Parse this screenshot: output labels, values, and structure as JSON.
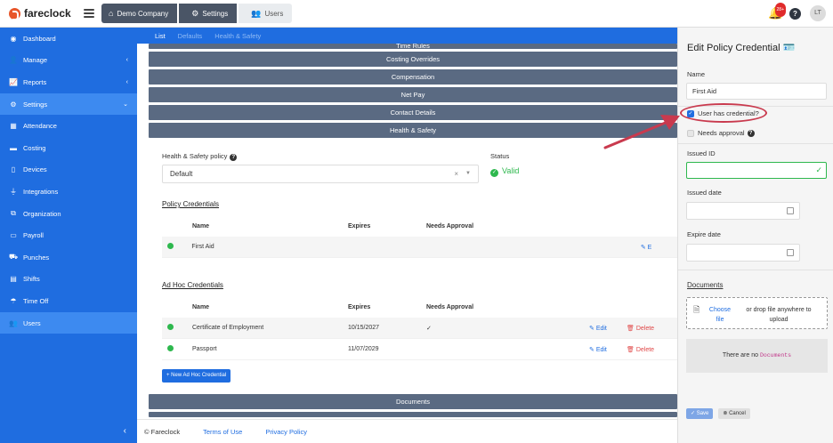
{
  "app": {
    "name": "fareclock"
  },
  "breadcrumbs": [
    {
      "label": "Demo Company",
      "icon": "home-icon"
    },
    {
      "label": "Settings",
      "icon": "gear-icon"
    },
    {
      "label": "Users",
      "icon": "users-icon"
    }
  ],
  "topbar": {
    "notifications": "28+",
    "help": "?",
    "avatar": "LT"
  },
  "sidebar": {
    "items": [
      {
        "label": "Dashboard",
        "icon": "dashboard-icon",
        "chevron": ""
      },
      {
        "label": "Manage",
        "icon": "person-icon",
        "chevron": "‹"
      },
      {
        "label": "Reports",
        "icon": "chart-icon",
        "chevron": "‹"
      },
      {
        "label": "Settings",
        "icon": "gear-icon",
        "chevron": "⌄"
      },
      {
        "label": "Attendance",
        "icon": "calendar-icon",
        "chevron": ""
      },
      {
        "label": "Costing",
        "icon": "folder-icon",
        "chevron": ""
      },
      {
        "label": "Devices",
        "icon": "device-icon",
        "chevron": ""
      },
      {
        "label": "Integrations",
        "icon": "plug-icon",
        "chevron": ""
      },
      {
        "label": "Organization",
        "icon": "sitemap-icon",
        "chevron": ""
      },
      {
        "label": "Payroll",
        "icon": "money-icon",
        "chevron": ""
      },
      {
        "label": "Punches",
        "icon": "truck-icon",
        "chevron": ""
      },
      {
        "label": "Shifts",
        "icon": "clipboard-icon",
        "chevron": ""
      },
      {
        "label": "Time Off",
        "icon": "beach-icon",
        "chevron": ""
      },
      {
        "label": "Users",
        "icon": "users-icon",
        "chevron": ""
      }
    ],
    "collapse": "‹"
  },
  "main": {
    "tabs": [
      "List",
      "Defaults",
      "Health & Safety"
    ],
    "top_stub": "Time Rules",
    "sections": [
      "Costing Overrides",
      "Compensation",
      "Net Pay",
      "Contact Details",
      "Health & Safety"
    ],
    "hs_policy_label": "Health & Safety policy",
    "hs_policy_value": "Default",
    "status_label": "Status",
    "status_value": "Valid",
    "policy_title": "Policy Credentials",
    "policy_headers": [
      "Name",
      "Expires",
      "Needs Approval"
    ],
    "policy_rows": [
      {
        "name": "First Aid",
        "expires": "",
        "approval": "",
        "edit": "E"
      }
    ],
    "adhoc_title": "Ad Hoc Credentials",
    "adhoc_headers": [
      "Name",
      "Expires",
      "Needs Approval"
    ],
    "adhoc_rows": [
      {
        "name": "Certificate of Employment",
        "expires": "10/15/2027",
        "approval": "✓",
        "edit": "Edit",
        "delete": "Delete"
      },
      {
        "name": "Passport",
        "expires": "11/07/2029",
        "approval": "",
        "edit": "Edit",
        "delete": "Delete"
      }
    ],
    "new_button": "+ New Ad Hoc Credential",
    "bottom_sections": [
      "Documents"
    ]
  },
  "footer": {
    "copyright": "© Fareclock",
    "terms": "Terms of Use",
    "privacy": "Privacy Policy"
  },
  "panel": {
    "title": "Edit Policy Credential",
    "name_label": "Name",
    "name_value": "First Aid",
    "has_credential_label": "User has credential?",
    "needs_approval_label": "Needs approval",
    "issued_id_label": "Issued ID",
    "issued_date_label": "Issued date",
    "expire_date_label": "Expire date",
    "documents_label": "Documents",
    "choose_file": "Choose file",
    "drop_text": "or drop file anywhere to upload",
    "no_docs_prefix": "There are no",
    "no_docs_key": "Documents",
    "save": "Save",
    "cancel": "Cancel"
  },
  "colors": {
    "primary": "#1f6de0",
    "bar": "#5a6a82",
    "valid": "#2eb84e",
    "delete": "#e04848",
    "annotation": "#c93a4e"
  }
}
